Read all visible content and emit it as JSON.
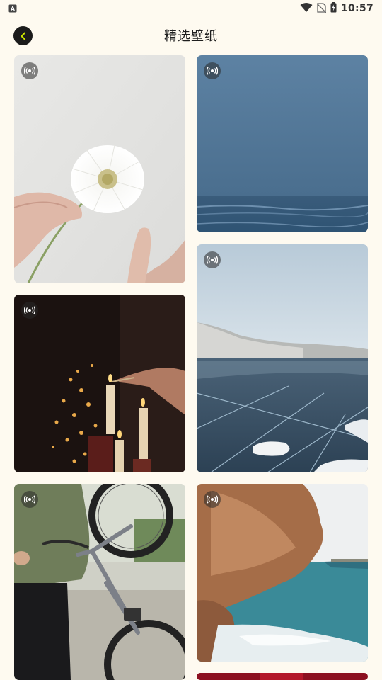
{
  "status_bar": {
    "time": "10:57",
    "icons": [
      "notification-a-icon",
      "wifi-icon",
      "no-sim-icon",
      "battery-charging-icon"
    ]
  },
  "header": {
    "title": "精选壁纸",
    "back_icon": "chevron-left-icon",
    "accent_color": "#c8e000"
  },
  "wallpapers": [
    {
      "subject": "white-flower",
      "live_icon": "live-wallpaper-icon"
    },
    {
      "subject": "blue-sea",
      "live_icon": "live-wallpaper-icon"
    },
    {
      "subject": "candles",
      "live_icon": "live-wallpaper-icon"
    },
    {
      "subject": "frozen-lake",
      "live_icon": "live-wallpaper-icon"
    },
    {
      "subject": "bicycle",
      "live_icon": "live-wallpaper-icon"
    },
    {
      "subject": "rocky-coast",
      "live_icon": "live-wallpaper-icon"
    },
    {
      "subject": "red-partial",
      "live_icon": "none"
    }
  ]
}
